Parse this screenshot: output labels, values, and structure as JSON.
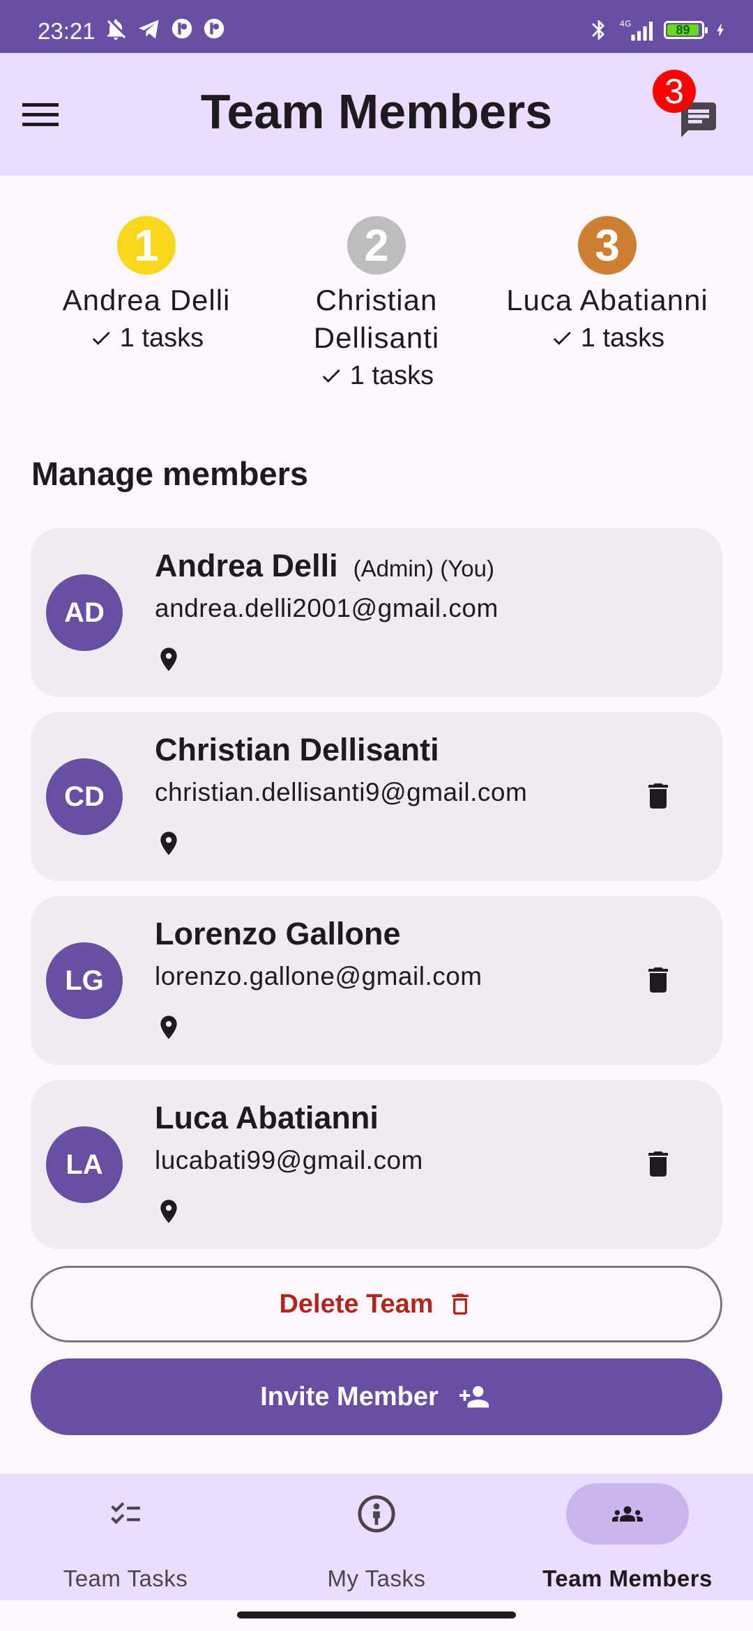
{
  "status_bar": {
    "time": "23:21",
    "battery": "89",
    "network": "4G"
  },
  "app_bar": {
    "title": "Team Members",
    "chat_badge": "3"
  },
  "podium": [
    {
      "rank": "1",
      "name": "Andrea Delli",
      "tasks": "1 tasks",
      "color": "#f9d71c"
    },
    {
      "rank": "2",
      "name": "Christian Dellisanti",
      "tasks": "1 tasks",
      "color": "#bdbdbd"
    },
    {
      "rank": "3",
      "name": "Luca Abatianni",
      "tasks": "1 tasks",
      "color": "#cd7f32"
    }
  ],
  "section_title": "Manage members",
  "members": [
    {
      "initials": "AD",
      "name": "Andrea Delli",
      "role": "(Admin) (You)",
      "email": "andrea.delli2001@gmail.com"
    },
    {
      "initials": "CD",
      "name": "Christian Dellisanti",
      "role": "",
      "email": "christian.dellisanti9@gmail.com"
    },
    {
      "initials": "LG",
      "name": "Lorenzo Gallone",
      "role": "",
      "email": "lorenzo.gallone@gmail.com"
    },
    {
      "initials": "LA",
      "name": "Luca Abatianni",
      "role": "",
      "email": "lucabati99@gmail.com"
    }
  ],
  "buttons": {
    "delete_team": "Delete Team",
    "invite_member": "Invite Member"
  },
  "bottom_nav": [
    {
      "label": "Team Tasks",
      "icon": "checklist-icon",
      "active": false
    },
    {
      "label": "My Tasks",
      "icon": "person-icon",
      "active": false
    },
    {
      "label": "Team Members",
      "icon": "groups-icon",
      "active": true
    }
  ],
  "colors": {
    "primary": "#6750a4",
    "surface_container": "#eaddff",
    "card": "#efecf0",
    "error": "#b3261e"
  }
}
